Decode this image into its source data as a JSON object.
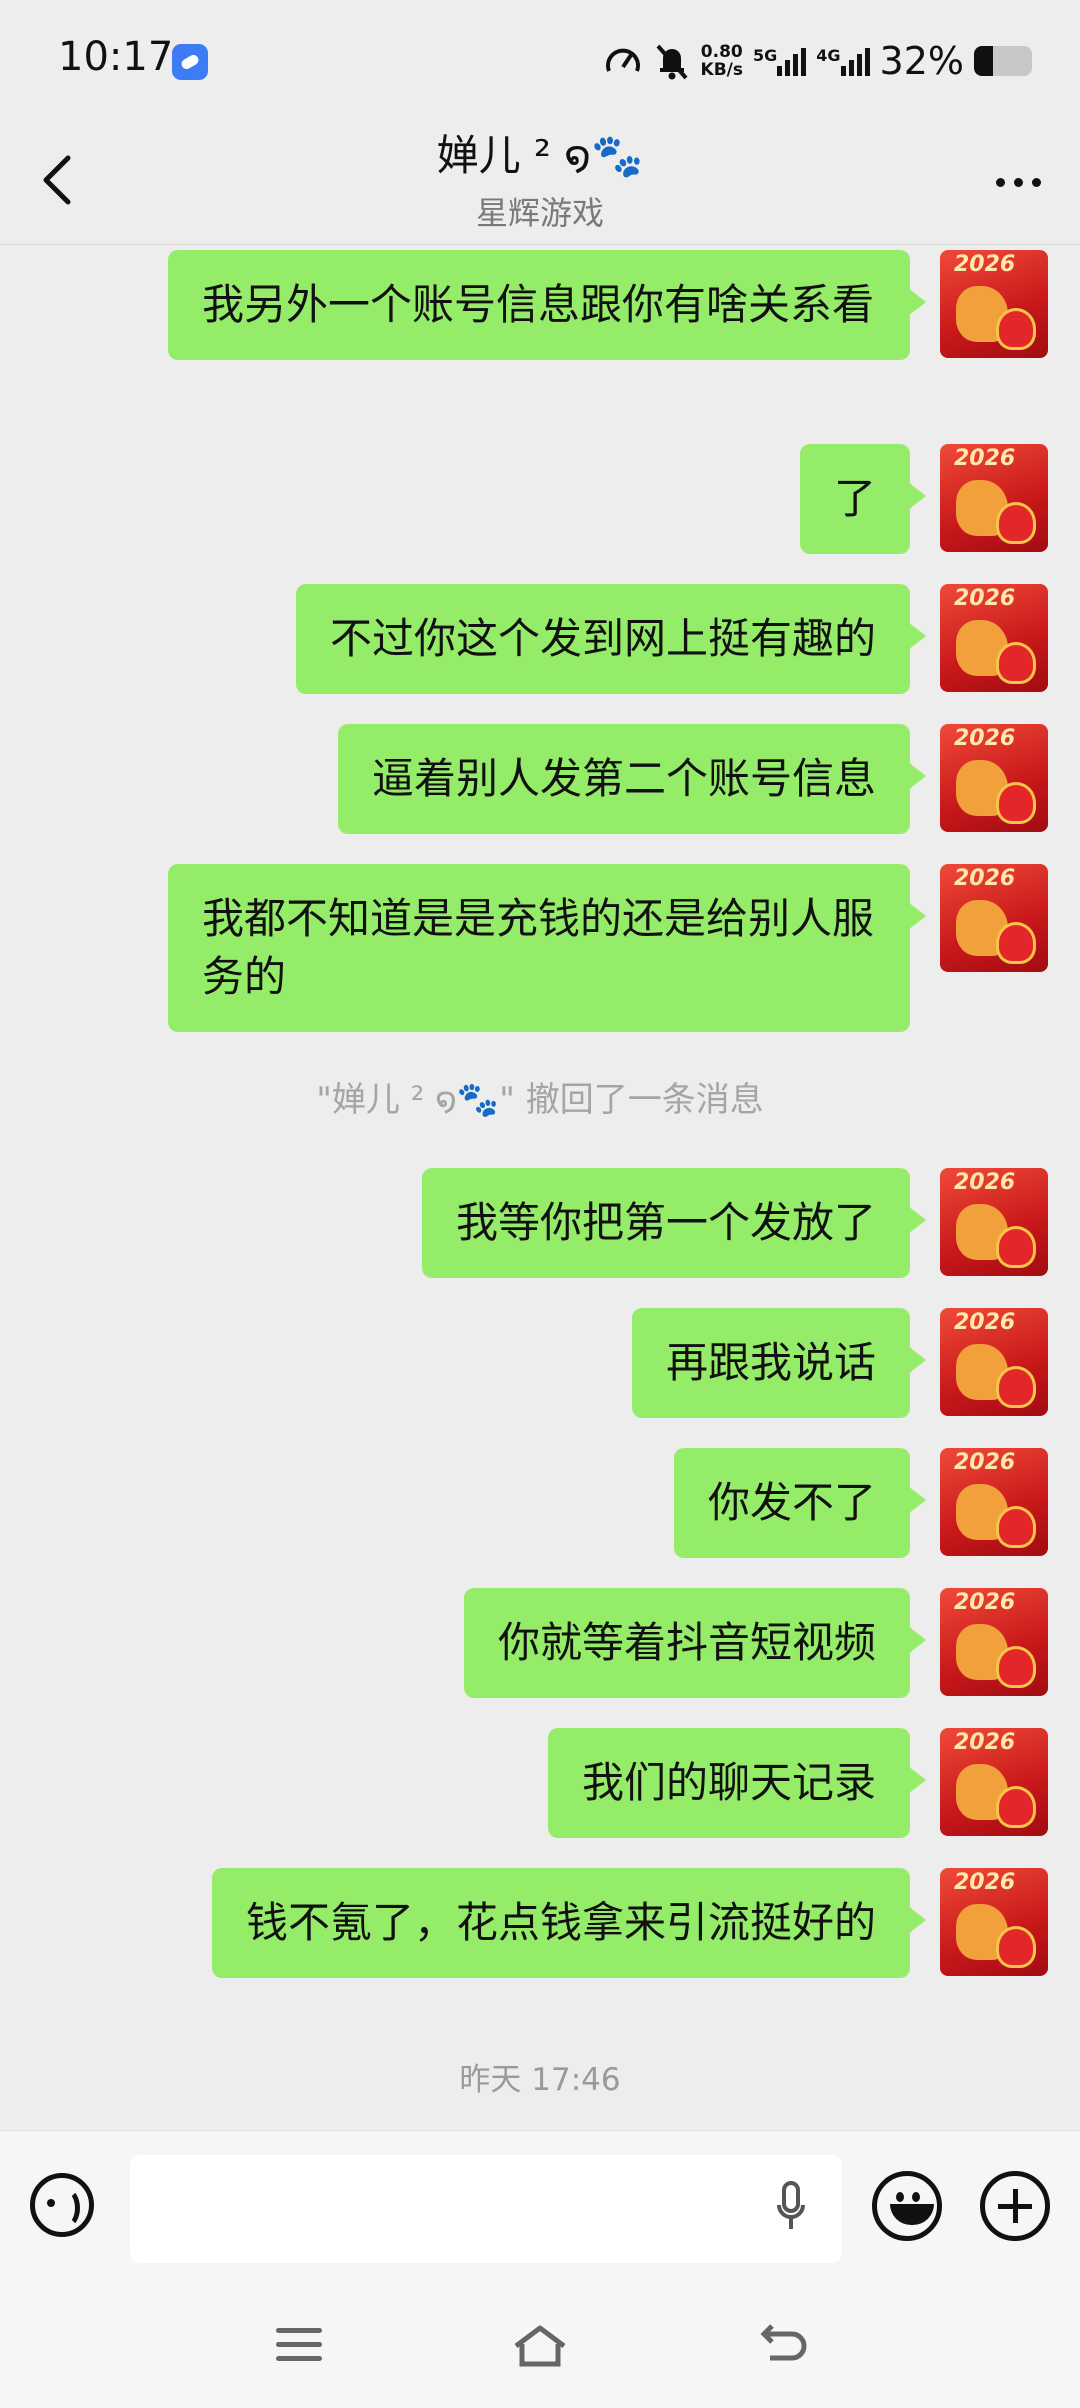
{
  "status_bar": {
    "time": "10:17",
    "net_speed_value": "0.80",
    "net_speed_unit": "KB/s",
    "network_1": "5G",
    "network_2": "4G",
    "battery_percent_text": "32%",
    "battery_level": 0.32
  },
  "header": {
    "title": "婵儿 ² ໑🐾",
    "subtitle": "星辉游戏"
  },
  "messages": [
    {
      "text": "我另外一个账号信息跟你有啥关系看"
    },
    {
      "text": "了"
    },
    {
      "text": "不过你这个发到网上挺有趣的"
    },
    {
      "text": "逼着别人发第二个账号信息"
    },
    {
      "text": "我都不知道是是充钱的还是给别人服务的"
    },
    {
      "text": "我等你把第一个发放了"
    },
    {
      "text": "再跟我说话"
    },
    {
      "text": "你发不了"
    },
    {
      "text": "你就等着抖音短视频"
    },
    {
      "text": "我们的聊天记录"
    },
    {
      "text": "钱不氪了，花点钱拿来引流挺好的"
    }
  ],
  "system_note": "\"婵儿 ² ໑🐾\" 撤回了一条消息",
  "timestamp": "昨天 17:46",
  "avatar_text": "2026",
  "input": {
    "value": "",
    "placeholder": ""
  },
  "colors": {
    "bubble": "#95EC69",
    "background": "#EDEDED"
  }
}
